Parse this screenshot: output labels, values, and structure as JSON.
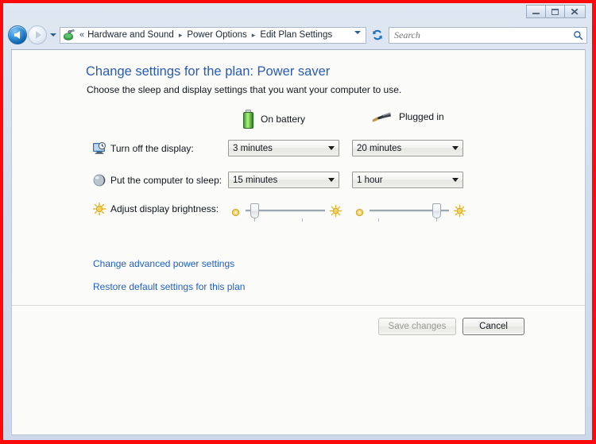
{
  "window": {
    "controls": {
      "minimize": "Minimize",
      "maximize": "Restore",
      "close": "Close",
      "close_glyph": "✕"
    }
  },
  "navbar": {
    "back_tooltip": "Back",
    "forward_tooltip": "Forward",
    "recent_pages_tooltip": "Recent pages",
    "chevrons": "«",
    "breadcrumbs": [
      {
        "label": "Hardware and Sound"
      },
      {
        "label": "Power Options"
      },
      {
        "label": "Edit Plan Settings"
      }
    ],
    "separator": "▸",
    "refresh_tooltip": "Refresh",
    "search": {
      "placeholder": "Search",
      "value": ""
    }
  },
  "page": {
    "heading": "Change settings for the plan: Power saver",
    "subheading": "Choose the sleep and display settings that you want your computer to use.",
    "columns": [
      {
        "key": "battery",
        "label": "On battery",
        "icon": "battery-icon"
      },
      {
        "key": "plugged",
        "label": "Plugged in",
        "icon": "power-plug-icon"
      }
    ],
    "settings": [
      {
        "id": "turn-off-display",
        "icon": "display-clock-icon",
        "label": "Turn off the display:",
        "type": "dropdown",
        "battery_value": "3 minutes",
        "plugged_value": "20 minutes"
      },
      {
        "id": "sleep",
        "icon": "sleep-orb-icon",
        "label": "Put the computer to sleep:",
        "type": "dropdown",
        "battery_value": "15 minutes",
        "plugged_value": "1 hour"
      },
      {
        "id": "brightness",
        "icon": "brightness-sun-icon",
        "label": "Adjust display brightness:",
        "type": "slider",
        "battery_value": 12,
        "plugged_value": 88
      }
    ],
    "links": [
      {
        "id": "advanced",
        "label": "Change advanced power settings"
      },
      {
        "id": "restore",
        "label": "Restore default settings for this plan"
      }
    ],
    "footer": {
      "save_label": "Save changes",
      "save_enabled": false,
      "cancel_label": "Cancel",
      "cancel_enabled": true
    }
  },
  "colors": {
    "link": "#1f5fc0",
    "heading": "#2b5bb3",
    "battery_green": "#6cc04a",
    "frame_red": "#ff0a0a",
    "content_bg": "#fbfcf9"
  }
}
